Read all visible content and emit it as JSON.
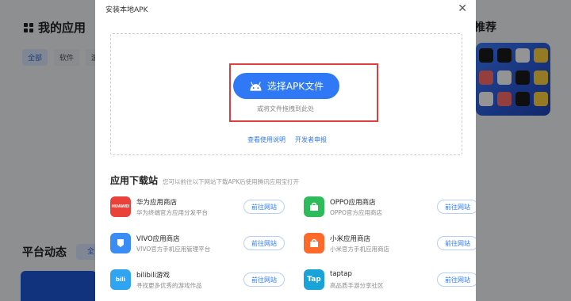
{
  "background": {
    "title": "我的应用",
    "filters": [
      "全部",
      "软件",
      "游"
    ],
    "right_title": "推荐",
    "section2_title": "平台动态",
    "section2_chip": "全"
  },
  "modal": {
    "title": "安装本地APK",
    "close_icon": "close-icon",
    "choose_button": "选择APK文件",
    "drag_hint": "或将文件拖拽到此处",
    "link_guide": "查看使用说明",
    "link_developer": "开发者申报"
  },
  "download": {
    "title": "应用下载站",
    "subtitle": "您可以前往以下网站下载APK后使用腾讯应用宝打开",
    "go_label": "前往网站",
    "stores": [
      {
        "name": "华为应用商店",
        "desc": "华为终端官方应用分发平台",
        "logo_text": "HUAWEI",
        "color": "#e8423a"
      },
      {
        "name": "OPPO应用商店",
        "desc": "OPPO官方应用商店",
        "logo_text": "",
        "color": "#2dbb5b"
      },
      {
        "name": "VIVO应用商店",
        "desc": "VIVO官方手机应用管理平台",
        "logo_text": "",
        "color": "#3a8df5"
      },
      {
        "name": "小米应用商店",
        "desc": "小米官方手机应用商店",
        "logo_text": "",
        "color": "#ff6a2b"
      },
      {
        "name": "bilibili游戏",
        "desc": "寻找更多优秀的游戏作品",
        "logo_text": "bili",
        "color": "#2fa4f0"
      },
      {
        "name": "taptap",
        "desc": "高品质手游分享社区",
        "logo_text": "Tap",
        "color": "#1aa3d8"
      }
    ]
  }
}
